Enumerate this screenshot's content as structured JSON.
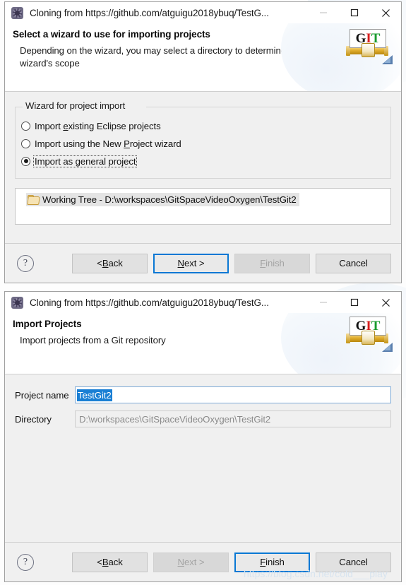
{
  "dialog_one": {
    "titlebar": {
      "icon": "git-clone-window-icon",
      "title": "Cloning from https://github.com/atguigu2018ybuq/TestG...",
      "minimize": "minimize-icon",
      "maximize": "maximize-icon",
      "close": "close-icon"
    },
    "header": {
      "title": "Select a wizard to use for importing projects",
      "description": "Depending on the wizard, you may select a directory to determine the wizard's scope",
      "logo_text": {
        "g": "G",
        "i": "I",
        "t": "T"
      }
    },
    "group": {
      "legend": "Wizard for project import",
      "options": [
        {
          "label_before": "Import ",
          "mnemonic": "e",
          "label_after": "xisting Eclipse projects",
          "checked": false,
          "focused": false
        },
        {
          "label_before": "Import using the New ",
          "mnemonic": "P",
          "label_after": "roject wizard",
          "checked": false,
          "focused": false
        },
        {
          "label_before": "Import as ",
          "mnemonic": "g",
          "label_after": "eneral project",
          "checked": true,
          "focused": true
        }
      ]
    },
    "tree": {
      "item_icon": "folder-icon",
      "item_label": "Working Tree - D:\\workspaces\\GitSpaceVideoOxygen\\TestGit2"
    },
    "buttons": {
      "help": "?",
      "back": {
        "before": "< ",
        "mnemonic": "B",
        "after": "ack",
        "state": "enabled"
      },
      "next": {
        "before": "",
        "mnemonic": "N",
        "after": "ext >",
        "state": "focused"
      },
      "finish": {
        "before": "",
        "mnemonic": "F",
        "after": "inish",
        "state": "disabled"
      },
      "cancel": {
        "before": "Cancel",
        "mnemonic": "",
        "after": "",
        "state": "enabled"
      }
    }
  },
  "dialog_two": {
    "titlebar": {
      "icon": "git-clone-window-icon",
      "title": "Cloning from https://github.com/atguigu2018ybuq/TestG...",
      "minimize": "minimize-icon",
      "maximize": "maximize-icon",
      "close": "close-icon"
    },
    "header": {
      "title": "Import Projects",
      "description": "Import projects from a Git repository",
      "logo_text": {
        "g": "G",
        "i": "I",
        "t": "T"
      }
    },
    "form": {
      "project_name_label": "Project name",
      "project_name_value": "TestGit2",
      "directory_label": "Directory",
      "directory_value": "D:\\workspaces\\GitSpaceVideoOxygen\\TestGit2"
    },
    "buttons": {
      "help": "?",
      "back": {
        "before": "< ",
        "mnemonic": "B",
        "after": "ack",
        "state": "enabled"
      },
      "next": {
        "before": "",
        "mnemonic": "N",
        "after": "ext >",
        "state": "disabled"
      },
      "finish": {
        "before": "",
        "mnemonic": "F",
        "after": "inish",
        "state": "focused"
      },
      "cancel": {
        "before": "Cancel",
        "mnemonic": "",
        "after": "",
        "state": "enabled"
      }
    },
    "watermark": "https://blog.csdn.net/cold___play"
  }
}
